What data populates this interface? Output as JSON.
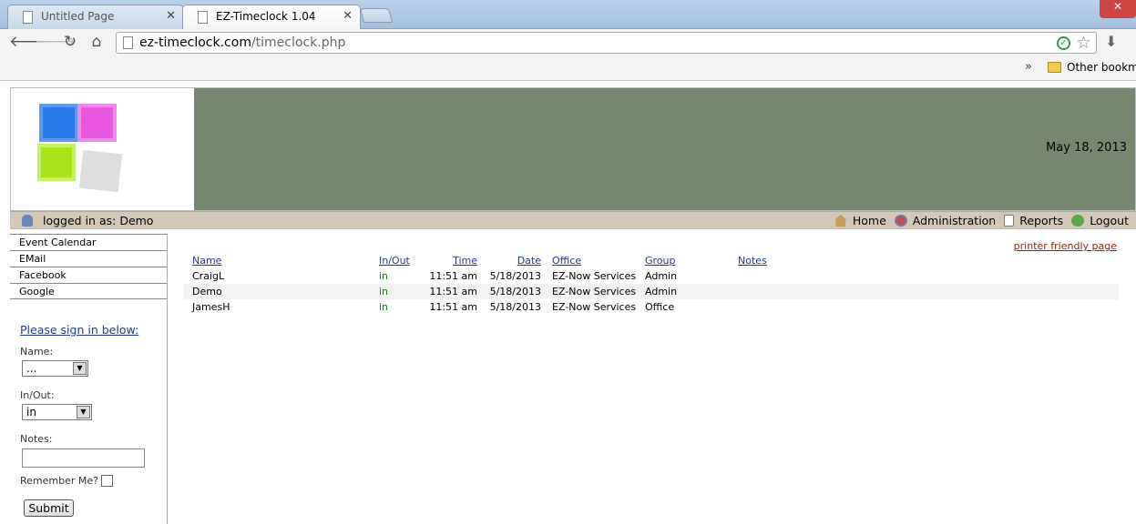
{
  "browser": {
    "tabs": [
      {
        "title": "Untitled Page",
        "active": false
      },
      {
        "title": "EZ-Timeclock 1.04",
        "active": true
      }
    ],
    "url_host": "ez-timeclock.com",
    "url_path": "/timeclock.php",
    "bookmarks": {
      "overflow": "»",
      "other_label": "Other bookmarks"
    }
  },
  "header": {
    "date": "May 18, 2013",
    "colors": {
      "banner": "#77876f"
    }
  },
  "userbar": {
    "logged_in": "logged in as: Demo",
    "nav": {
      "home": "Home",
      "administration": "Administration",
      "reports": "Reports",
      "logout": "Logout"
    }
  },
  "sidebar": {
    "links": [
      "Event Calendar",
      "EMail",
      "Facebook",
      "Google"
    ],
    "signin_heading": "Please sign in below:",
    "name_label": "Name:",
    "name_value": "...",
    "inout_label": "In/Out:",
    "inout_value": "in",
    "notes_label": "Notes:",
    "remember_label": "Remember Me?",
    "submit_label": "Submit"
  },
  "main": {
    "printer_link": "printer friendly page",
    "columns": {
      "name": "Name",
      "inout": "In/Out",
      "time": "Time",
      "date": "Date",
      "office": "Office",
      "group": "Group",
      "notes": "Notes"
    },
    "rows": [
      {
        "name": "CraigL",
        "inout": "in",
        "time": "11:51 am",
        "date": "5/18/2013",
        "office": "EZ-Now Services",
        "group": "Admin",
        "notes": ""
      },
      {
        "name": "Demo",
        "inout": "in",
        "time": "11:51 am",
        "date": "5/18/2013",
        "office": "EZ-Now Services",
        "group": "Admin",
        "notes": ""
      },
      {
        "name": "JamesH",
        "inout": "in",
        "time": "11:51 am",
        "date": "5/18/2013",
        "office": "EZ-Now Services",
        "group": "Office",
        "notes": ""
      }
    ]
  }
}
